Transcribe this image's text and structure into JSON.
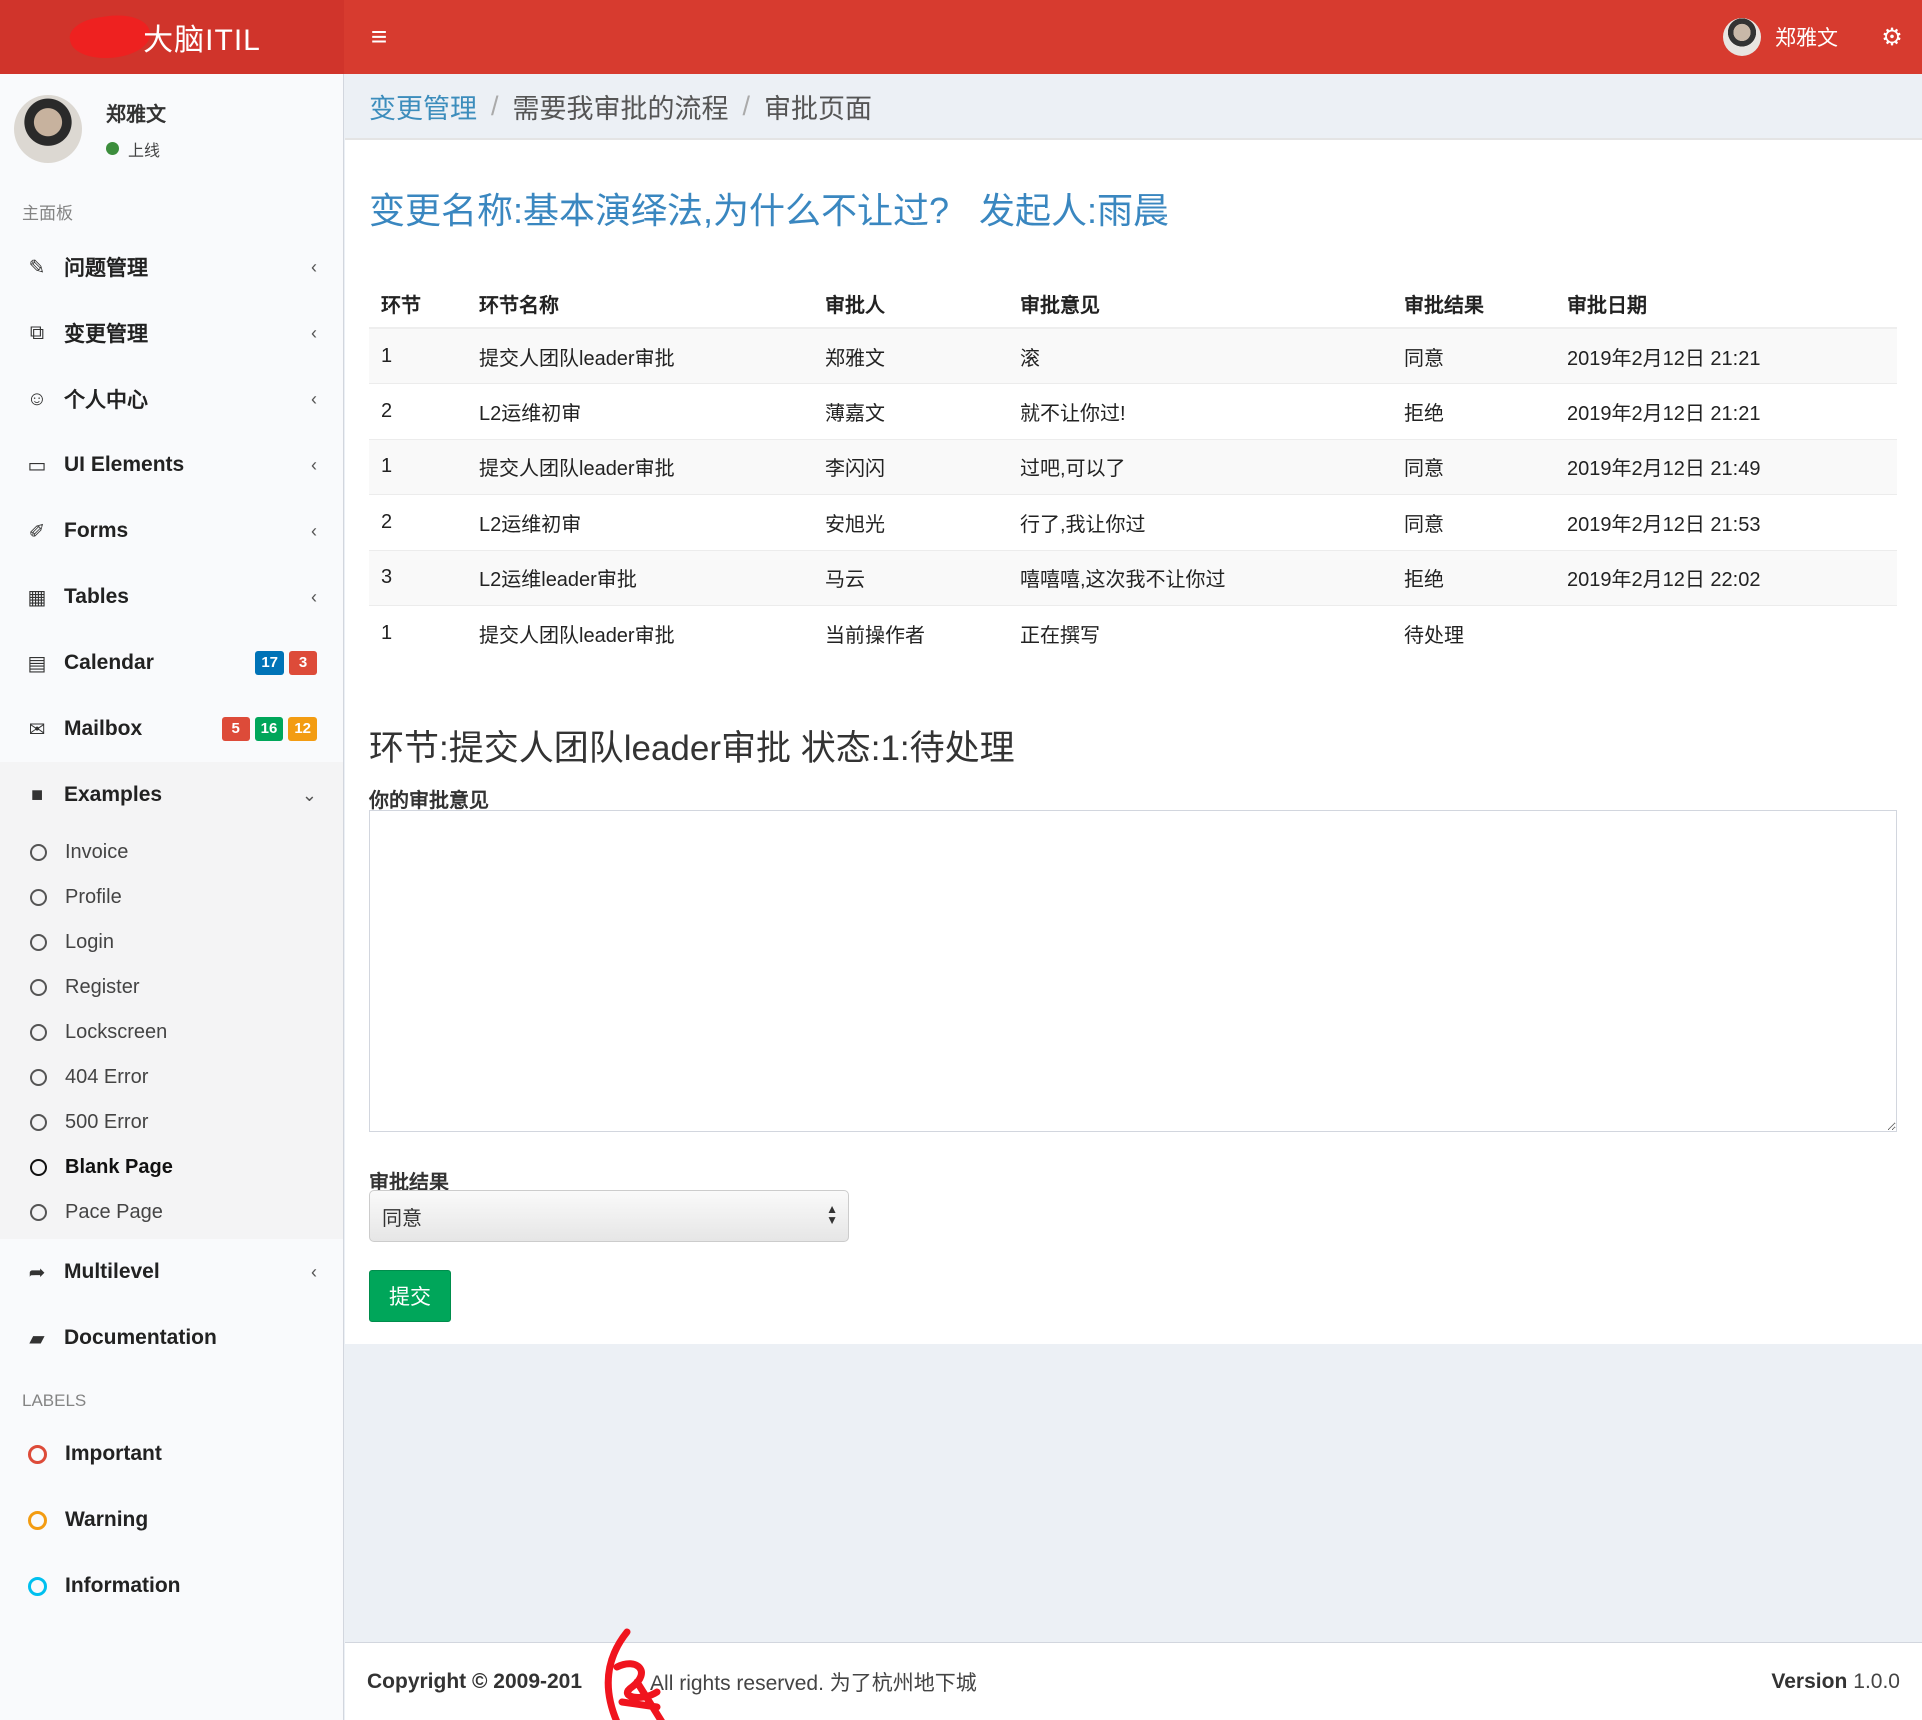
{
  "header": {
    "logo_text": "大脑ITIL",
    "menu_icon": "hamburger-icon",
    "user_name": "郑雅文",
    "settings_icon": "gears-icon"
  },
  "sidebar": {
    "user": {
      "name": "郑雅文",
      "status": "上线"
    },
    "header_main": "主面板",
    "items": [
      {
        "label": "问题管理",
        "icon": "pencil-icon",
        "glyph": "✎"
      },
      {
        "label": "变更管理",
        "icon": "copy-icon",
        "glyph": "⧉"
      },
      {
        "label": "个人中心",
        "icon": "smile-icon",
        "glyph": "☺"
      },
      {
        "label": "UI Elements",
        "icon": "laptop-icon",
        "glyph": "▭"
      },
      {
        "label": "Forms",
        "icon": "edit-icon",
        "glyph": "✐"
      },
      {
        "label": "Tables",
        "icon": "table-icon",
        "glyph": "▦"
      },
      {
        "label": "Calendar",
        "icon": "calendar-icon",
        "glyph": "▤",
        "badges": [
          "17",
          "3"
        ]
      },
      {
        "label": "Mailbox",
        "icon": "envelope-icon",
        "glyph": "✉",
        "badges": [
          "5",
          "16",
          "12"
        ]
      },
      {
        "label": "Examples",
        "icon": "folder-icon",
        "glyph": "■"
      },
      {
        "label": "Multilevel",
        "icon": "share-icon",
        "glyph": "➦"
      },
      {
        "label": "Documentation",
        "icon": "book-icon",
        "glyph": "▰"
      }
    ],
    "examples_sub": [
      "Invoice",
      "Profile",
      "Login",
      "Register",
      "Lockscreen",
      "404 Error",
      "500 Error",
      "Blank Page",
      "Pace Page"
    ],
    "header_labels": "LABELS",
    "labels": [
      {
        "label": "Important",
        "color": "#dd4b39"
      },
      {
        "label": "Warning",
        "color": "#f39c12"
      },
      {
        "label": "Information",
        "color": "#00c0ef"
      }
    ]
  },
  "breadcrumb": [
    "变更管理",
    "需要我审批的流程",
    "审批页面"
  ],
  "main": {
    "title": "变更名称:基本演绎法,为什么不让过?   发起人:雨晨",
    "table": {
      "headers": [
        "环节",
        "环节名称",
        "审批人",
        "审批意见",
        "审批结果",
        "审批日期"
      ],
      "rows": [
        [
          "1",
          "提交人团队leader审批",
          "郑雅文",
          "滚",
          "同意",
          "2019年2月12日 21:21"
        ],
        [
          "2",
          "L2运维初审",
          "薄嘉文",
          "就不让你过!",
          "拒绝",
          "2019年2月12日 21:21"
        ],
        [
          "1",
          "提交人团队leader审批",
          "李闪闪",
          "过吧,可以了",
          "同意",
          "2019年2月12日 21:49"
        ],
        [
          "2",
          "L2运维初审",
          "安旭光",
          "行了,我让你过",
          "同意",
          "2019年2月12日 21:53"
        ],
        [
          "3",
          "L2运维leader审批",
          "马云",
          "嘻嘻嘻,这次我不让你过",
          "拒绝",
          "2019年2月12日 22:02"
        ],
        [
          "1",
          "提交人团队leader审批",
          "当前操作者",
          "正在撰写",
          "待处理",
          ""
        ]
      ]
    },
    "stage_title": "环节:提交人团队leader审批 状态:1:待处理",
    "opinion_label": "你的审批意见",
    "opinion_value": "",
    "result_label": "审批结果",
    "result_value": "同意",
    "submit_label": "提交"
  },
  "footer": {
    "copyright_strong": "Copyright © 2009-201",
    "copyright_rest": "All rights reserved. 为了杭州地下城",
    "version_label": "Version",
    "version_value": "1.0.0"
  }
}
